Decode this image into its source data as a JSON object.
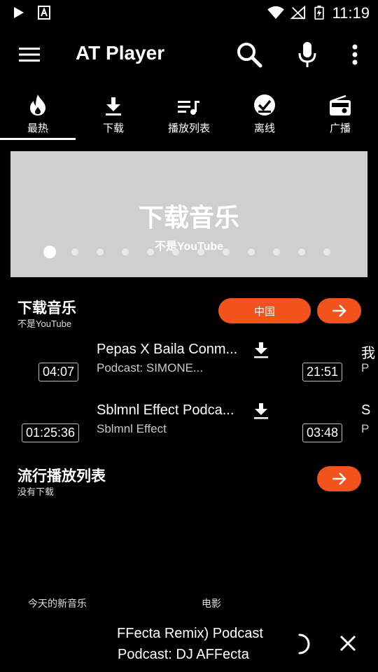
{
  "status_bar": {
    "time": "11:19"
  },
  "toolbar": {
    "title": "AT Player"
  },
  "tabs": [
    {
      "label": "最热",
      "icon": "fire-icon"
    },
    {
      "label": "下载",
      "icon": "download-icon"
    },
    {
      "label": "播放列表",
      "icon": "playlist-icon"
    },
    {
      "label": "离线",
      "icon": "offline-check-icon"
    },
    {
      "label": "广播",
      "icon": "radio-icon"
    }
  ],
  "banner": {
    "title": "下载音乐",
    "subtitle": "不是YouTube",
    "dot_count": 12,
    "active_dot": 0
  },
  "section_download": {
    "title": "下载音乐",
    "subtitle": "不是YouTube",
    "country_button": "中国"
  },
  "tracks": [
    {
      "duration": "04:07",
      "title": "Pepas X Baila Conm...",
      "subtitle": "Podcast: SIMONE..."
    },
    {
      "duration": "01:25:36",
      "title": "Sblmnl Effect Podca...",
      "subtitle": "Sblmnl Effect"
    }
  ],
  "tracks_col2": [
    {
      "duration": "21:51",
      "title_clip": "我",
      "sub_clip": "P"
    },
    {
      "duration": "03:48",
      "title_clip": "S",
      "sub_clip": "P"
    }
  ],
  "section_playlists": {
    "title": "流行播放列表",
    "subtitle": "没有下载"
  },
  "footer_labels": {
    "left": "今天的新音乐",
    "right": "电影"
  },
  "player": {
    "title": "AFFecta Remix) Podcast",
    "subtitle": "Podcast: DJ AFFecta"
  },
  "colors": {
    "accent": "#f2521c",
    "background": "#000000",
    "banner": "#cfcfcf"
  }
}
